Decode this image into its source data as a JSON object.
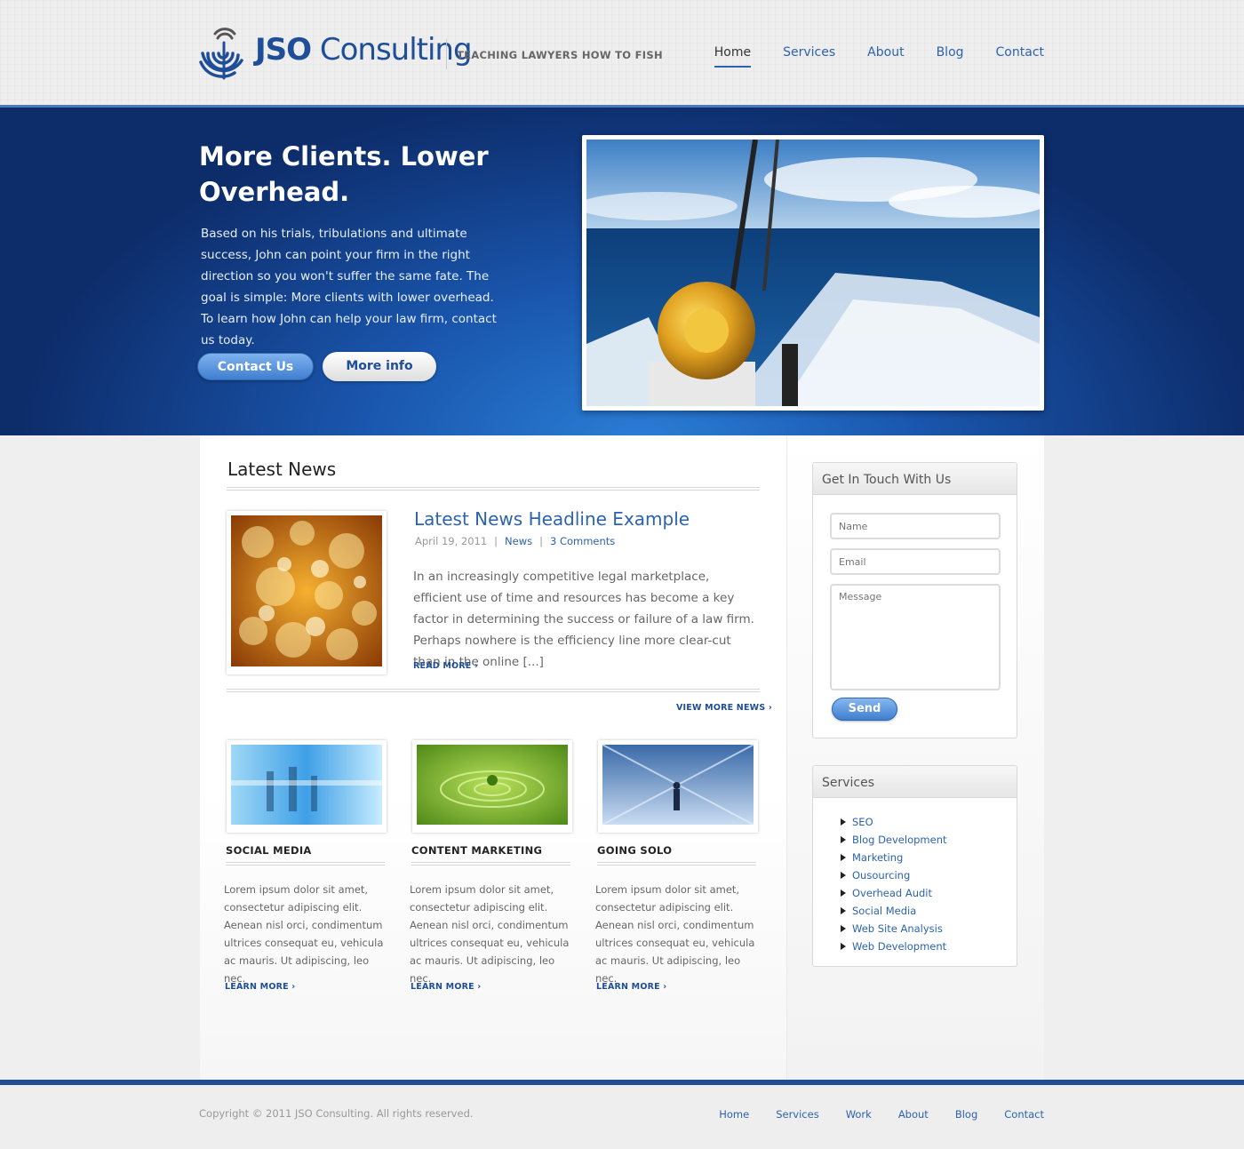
{
  "brand": {
    "name_bold": "JSO",
    "name_rest": " Consulting",
    "tagline": "TEACHING LAWYERS HOW TO FISH",
    "color": "#1f4e98"
  },
  "nav": {
    "items": [
      {
        "label": "Home",
        "active": true
      },
      {
        "label": "Services"
      },
      {
        "label": "About"
      },
      {
        "label": "Blog"
      },
      {
        "label": "Contact"
      }
    ]
  },
  "hero": {
    "title": "More Clients. Lower Overhead.",
    "text": "Based on his trials, tribulations and ultimate success, John can point your firm in the right direction so you won't suffer the same fate. The goal is simple: More clients with lower overhead. To learn how John can help your law firm, contact us today.",
    "contact_button": "Contact Us",
    "more_button": "More info",
    "image_icon": "fishing-reel-ocean-photo"
  },
  "news": {
    "section_title": "Latest News",
    "headline": "Latest News Headline Example",
    "date": "April 19, 2011",
    "category": "News",
    "comments": "3 Comments",
    "excerpt": "In an increasingly competitive legal marketplace, efficient use of time and resources has become a key factor in determining the success or failure of a law firm. Perhaps nowhere is the efficiency line more clear-cut than in the online [...]",
    "read_more": "READ MORE ›",
    "view_more": "VIEW MORE NEWS ›"
  },
  "features": [
    {
      "title": "SOCIAL MEDIA",
      "text": "Lorem ipsum dolor sit amet, consectetur adipiscing elit. Aenean nisl orci, condimentum ultrices consequat eu, vehicula ac mauris. Ut adipiscing, leo nec.",
      "link": "LEARN MORE ›"
    },
    {
      "title": "CONTENT MARKETING",
      "text": "Lorem ipsum dolor sit amet, consectetur adipiscing elit. Aenean nisl orci, condimentum ultrices consequat eu, vehicula ac mauris. Ut adipiscing, leo nec.",
      "link": "LEARN MORE ›"
    },
    {
      "title": "GOING SOLO",
      "text": "Lorem ipsum dolor sit amet, consectetur adipiscing elit. Aenean nisl orci, condimentum ultrices consequat eu, vehicula ac mauris. Ut adipiscing, leo nec.",
      "link": "LEARN MORE ›"
    }
  ],
  "contact_widget": {
    "title": "Get In Touch With Us",
    "name_placeholder": "Name",
    "email_placeholder": "Email",
    "message_placeholder": "Message",
    "send_label": "Send"
  },
  "services_widget": {
    "title": "Services",
    "items": [
      "SEO",
      "Blog Development",
      "Marketing",
      "Ousourcing",
      "Overhead Audit",
      "Social Media",
      "Web Site Analysis",
      "Web Development"
    ]
  },
  "footer": {
    "copyright": "Copyright © 2011 JSO Consulting. All rights reserved.",
    "links": [
      "Home",
      "Services",
      "Work",
      "About",
      "Blog",
      "Contact"
    ]
  }
}
